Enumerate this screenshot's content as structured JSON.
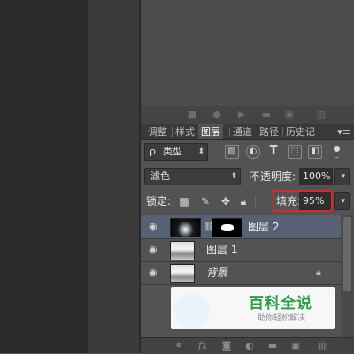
{
  "tabs": [
    {
      "label": "调整",
      "active": false
    },
    {
      "label": "样式",
      "active": false
    },
    {
      "label": "图层",
      "active": true
    },
    {
      "label": "通道",
      "active": false
    },
    {
      "label": "路径",
      "active": false
    },
    {
      "label": "历史记",
      "active": false
    }
  ],
  "panel_menu": "▾≡",
  "filter": {
    "search_symbol": "ρ",
    "kind_label": "类型"
  },
  "blend_mode": "滤色",
  "opacity": {
    "label": "不透明度:",
    "value": "100%"
  },
  "lock": {
    "label": "锁定:"
  },
  "fill": {
    "label": "填充:",
    "value": "95%"
  },
  "layers": [
    {
      "name": "图层 2",
      "selected": true,
      "visible": true
    },
    {
      "name": "图层 1",
      "selected": false,
      "visible": true
    },
    {
      "name": "背景",
      "selected": false,
      "visible": true,
      "locked": true
    }
  ],
  "watermark": {
    "title": "百科全说",
    "subtitle": "助你轻松解决"
  },
  "bottom_icons": [
    "link-icon",
    "fx-icon",
    "mask-icon",
    "adjustment-icon",
    "group-icon",
    "new-layer-icon",
    "trash-icon"
  ],
  "highlight_color": "#e0262b",
  "selection_color": "#566274"
}
